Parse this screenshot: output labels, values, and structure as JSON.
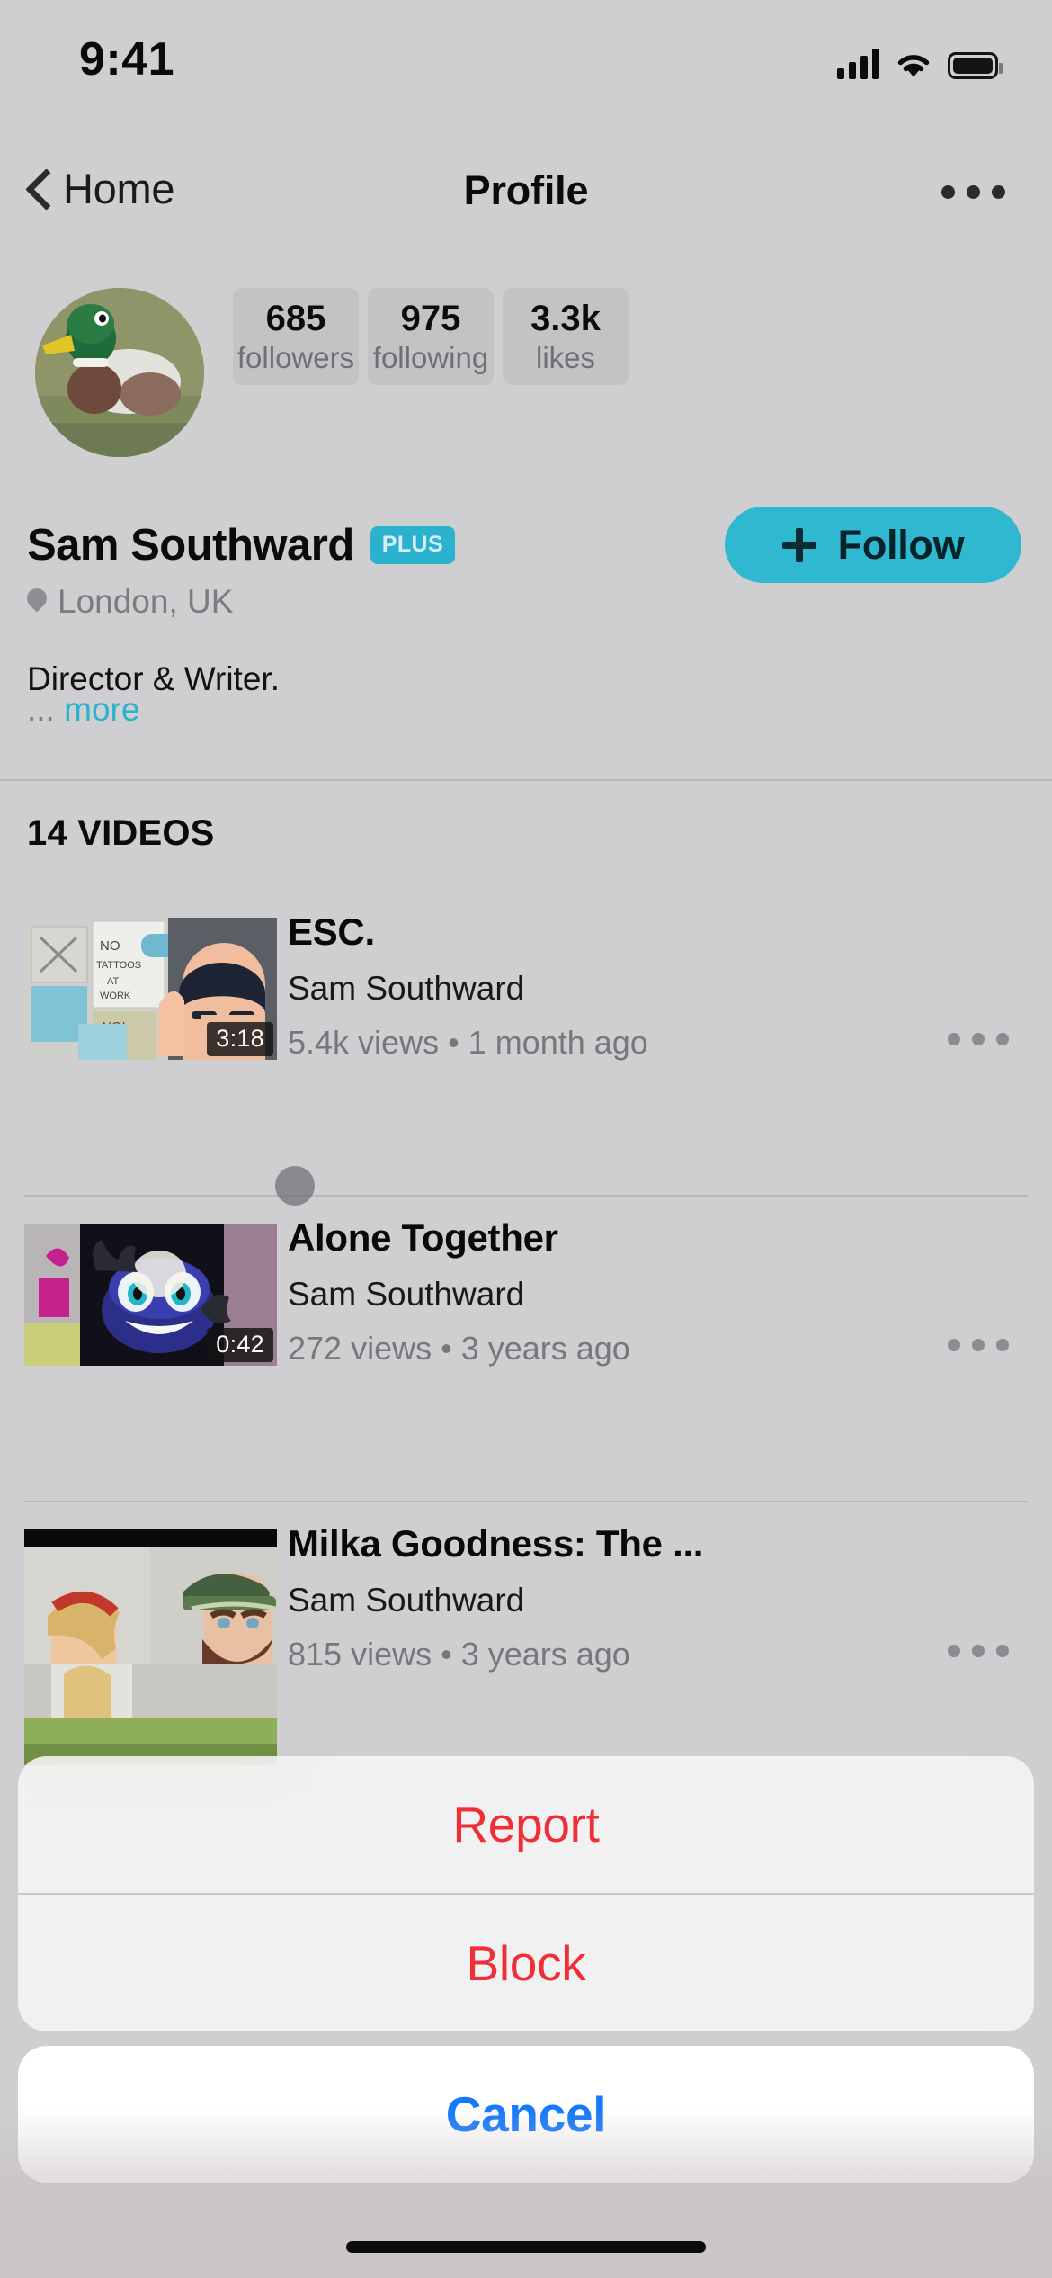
{
  "status_bar": {
    "time": "9:41",
    "cellular_icon": "signal-bars-icon",
    "wifi_icon": "wifi-icon",
    "battery_icon": "battery-full-icon"
  },
  "nav": {
    "back_icon": "chevron-left-icon",
    "back_label": "Home",
    "title": "Profile",
    "more_icon": "ellipsis-icon"
  },
  "profile": {
    "avatar_alt": "duck-avatar",
    "name": "Sam Southward",
    "badge": "PLUS",
    "location_icon": "location-pin-icon",
    "location": "London, UK",
    "bio": "Director & Writer.",
    "bio_truncation": "...",
    "bio_more_label": "more",
    "follow_icon": "plus-icon",
    "follow_label": "Follow",
    "follow_color": "#2fb8d0",
    "stats": [
      {
        "value": "685",
        "label": "followers"
      },
      {
        "value": "975",
        "label": "following"
      },
      {
        "value": "3.3k",
        "label": "likes"
      }
    ]
  },
  "videos_section": {
    "header": "14 VIDEOS",
    "items": [
      {
        "title": "ESC.",
        "author": "Sam Southward",
        "meta": "5.4k views • 1 month ago",
        "duration": "3:18",
        "more_icon": "ellipsis-icon"
      },
      {
        "title": "Alone Together",
        "author": "Sam Southward",
        "meta": "272 views • 3 years ago",
        "duration": "0:42",
        "more_icon": "ellipsis-icon"
      },
      {
        "title": "Milka Goodness: The ...",
        "author": "Sam Southward",
        "meta": "815 views • 3 years ago",
        "duration": "",
        "more_icon": "ellipsis-icon"
      }
    ]
  },
  "action_sheet": {
    "report_label": "Report",
    "block_label": "Block",
    "cancel_label": "Cancel",
    "destructive_color": "#ef2f38",
    "cancel_color": "#1579fb"
  }
}
